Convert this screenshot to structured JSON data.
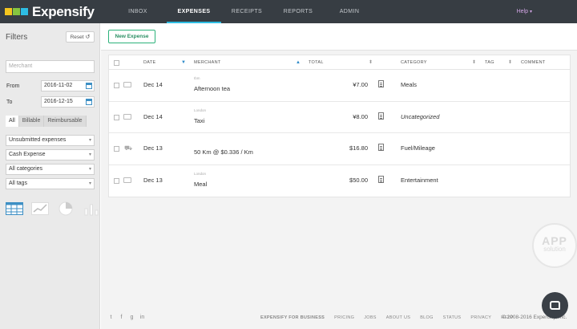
{
  "app": {
    "name": "Expensify"
  },
  "nav": [
    {
      "label": "INBOX",
      "active": false
    },
    {
      "label": "EXPENSES",
      "active": true
    },
    {
      "label": "RECEIPTS",
      "active": false
    },
    {
      "label": "REPORTS",
      "active": false
    },
    {
      "label": "ADMIN",
      "active": false
    }
  ],
  "help": {
    "label": "Help",
    "caret": "▾"
  },
  "sidebar": {
    "title": "Filters",
    "reset_label": "Reset",
    "reset_icon": "↺",
    "merchant_placeholder": "Merchant",
    "from_label": "From",
    "from_value": "2016-11-02",
    "to_label": "To",
    "to_value": "2016-12-15",
    "segments": [
      "All",
      "Billable",
      "Reimbursable"
    ],
    "dropdowns": [
      "Unsubmitted expenses",
      "Cash Expense",
      "All categories",
      "All tags"
    ],
    "dropdown_caret": "▾",
    "views": [
      "table-view-icon",
      "line-chart-icon",
      "pie-chart-icon",
      "bar-chart-icon"
    ]
  },
  "toolbar": {
    "new_expense_label": "New Expense"
  },
  "table": {
    "headers": {
      "date": "DATE",
      "merchant": "MERCHANT",
      "total": "TOTAL",
      "category": "CATEGORY",
      "tag": "TAG",
      "comment": "COMMENT"
    },
    "sort_icon": "⬍",
    "sort_up": "▲",
    "sort_down": "▼",
    "rows": [
      {
        "date": "Dec 14",
        "location": "Ibm",
        "merchant": "Afternoon tea",
        "amount": "¥7.00",
        "category": "Meals",
        "italic": false,
        "icon": "receipt-icon"
      },
      {
        "date": "Dec 14",
        "location": "London",
        "merchant": "Taxi",
        "amount": "¥8.00",
        "category": "Uncategorized",
        "italic": true,
        "icon": "receipt-icon"
      },
      {
        "date": "Dec 13",
        "location": "",
        "merchant": "50 Km @ $0.336 / Km",
        "amount": "$16.80",
        "category": "Fuel/Mileage",
        "italic": false,
        "icon": "car-icon",
        "car_glyph": "⛟"
      },
      {
        "date": "Dec 13",
        "location": "London",
        "merchant": "Meal",
        "amount": "$50.00",
        "category": "Entertainment",
        "italic": false,
        "icon": "receipt-icon"
      }
    ]
  },
  "watermark": {
    "line1": "APP",
    "line2": "solution"
  },
  "footer": {
    "social": [
      "t",
      "f",
      "g",
      "in"
    ],
    "links": [
      "EXPENSIFY FOR BUSINESS",
      "PRICING",
      "JOBS",
      "ABOUT US",
      "BLOG",
      "STATUS",
      "PRIVACY",
      "HELP"
    ],
    "copyright": "© 2008-2016 Expensify, Inc."
  },
  "colors": {
    "accent": "#2ebde3",
    "topbar": "#373d43",
    "new_expense_border": "#2cb27a",
    "help": "#d3a6e6"
  }
}
